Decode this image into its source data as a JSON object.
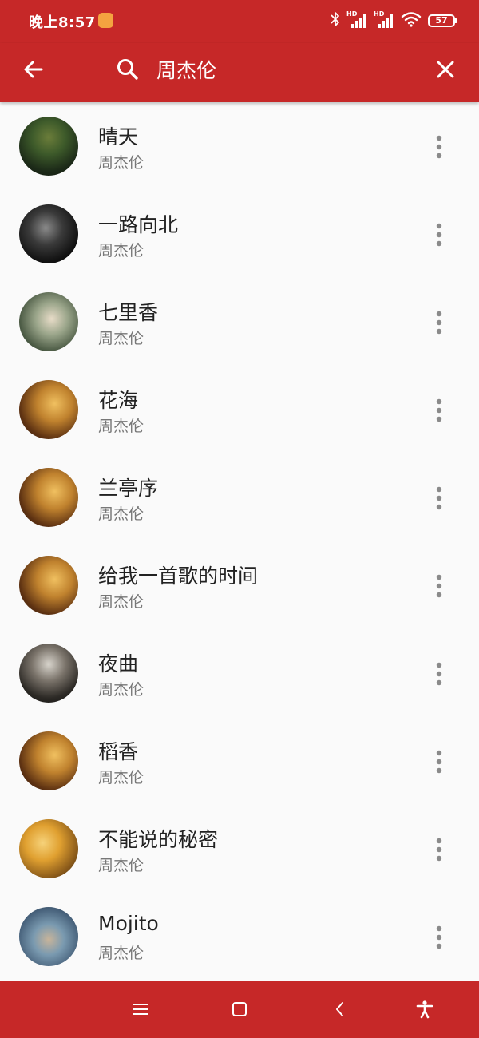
{
  "status_bar": {
    "time": "晚上8:57",
    "battery": "57",
    "hd_label": "HD",
    "icons": [
      "app-notification-icon",
      "bluetooth-icon",
      "signal-hd-icon",
      "signal-hd-icon",
      "wifi-icon",
      "battery-icon"
    ]
  },
  "search": {
    "query": "周杰伦",
    "icons": [
      "back-arrow-icon",
      "search-icon",
      "close-icon"
    ]
  },
  "songs": [
    {
      "title": "晴天",
      "artist": "周杰伦"
    },
    {
      "title": "一路向北",
      "artist": "周杰伦"
    },
    {
      "title": "七里香",
      "artist": "周杰伦"
    },
    {
      "title": "花海",
      "artist": "周杰伦"
    },
    {
      "title": "兰亭序",
      "artist": "周杰伦"
    },
    {
      "title": "给我一首歌的时间",
      "artist": "周杰伦"
    },
    {
      "title": "夜曲",
      "artist": "周杰伦"
    },
    {
      "title": "稻香",
      "artist": "周杰伦"
    },
    {
      "title": "不能说的秘密",
      "artist": "周杰伦"
    },
    {
      "title": "Mojito",
      "artist": "周杰伦"
    }
  ],
  "nav_bar": {
    "icons": [
      "menu-icon",
      "home-square-icon",
      "back-chevron-icon",
      "accessibility-icon"
    ]
  },
  "colors": {
    "primary": "#c62828",
    "background": "#fafafa",
    "title_text": "#222222",
    "subtitle_text": "#777777",
    "more_dots": "#8a8a8a"
  }
}
